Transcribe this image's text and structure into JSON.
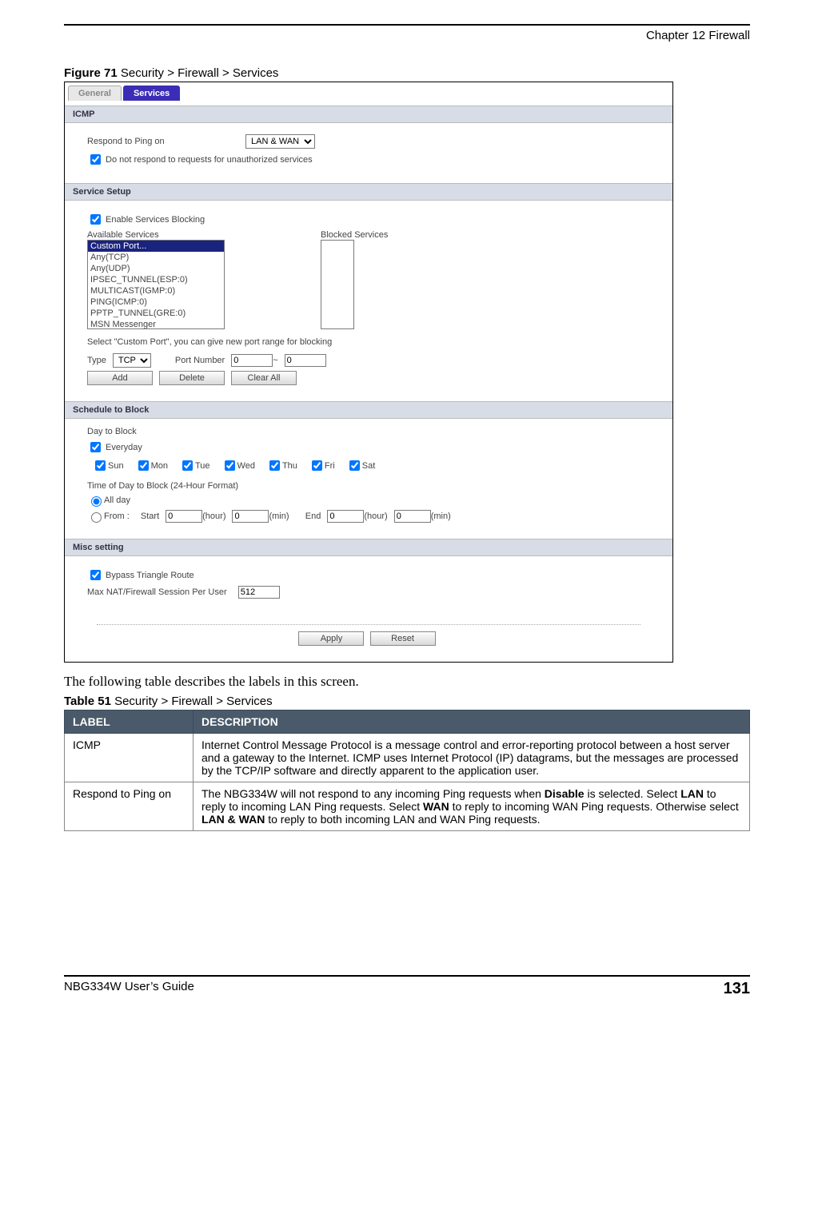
{
  "chapter_header": "Chapter 12 Firewall",
  "figure_caption_bold": "Figure 71",
  "figure_caption_rest": "   Security > Firewall > Services",
  "tabs": {
    "general": "General",
    "services": "Services"
  },
  "icmp": {
    "title": "ICMP",
    "respond_label": "Respond to Ping on",
    "respond_value": "LAN & WAN",
    "no_respond_label": "Do not respond to requests for unauthorized services"
  },
  "service_setup": {
    "title": "Service Setup",
    "enable_label": "Enable Services Blocking",
    "available_label": "Available Services",
    "blocked_label": "Blocked Services",
    "items": [
      "Custom Port...",
      "Any(TCP)",
      "Any(UDP)",
      "IPSEC_TUNNEL(ESP:0)",
      "MULTICAST(IGMP:0)",
      "PING(ICMP:0)",
      "PPTP_TUNNEL(GRE:0)",
      "MSN Messenger"
    ],
    "hint": "Select \"Custom Port\", you can give new port range for blocking",
    "type_label": "Type",
    "type_value": "TCP",
    "port_label": "Port Number",
    "port_from": "0",
    "port_tilde": "~",
    "port_to": "0",
    "btn_add": "Add",
    "btn_delete": "Delete",
    "btn_clear": "Clear All"
  },
  "schedule": {
    "title": "Schedule to Block",
    "day_label": "Day to Block",
    "everyday": "Everyday",
    "days": [
      "Sun",
      "Mon",
      "Tue",
      "Wed",
      "Thu",
      "Fri",
      "Sat"
    ],
    "time_label": "Time of Day to Block (24-Hour Format)",
    "allday": "All day",
    "from": "From :",
    "start": "Start",
    "hour_unit": "(hour)",
    "min_unit": "(min)",
    "end": "End",
    "val0": "0"
  },
  "misc": {
    "title": "Misc setting",
    "bypass": "Bypass Triangle Route",
    "max_label": "Max NAT/Firewall Session Per User",
    "max_value": "512"
  },
  "footer_btns": {
    "apply": "Apply",
    "reset": "Reset"
  },
  "after_figure": "The following table describes the labels in this screen.",
  "table_caption_bold": "Table 51",
  "table_caption_rest": "   Security > Firewall > Services",
  "table": {
    "h1": "LABEL",
    "h2": "DESCRIPTION",
    "r1c1": "ICMP",
    "r1c2": "Internet Control Message Protocol is a message control and error-reporting protocol between a host server and a gateway to the Internet. ICMP uses Internet Protocol (IP) datagrams, but the messages are processed by the TCP/IP software and directly apparent to the application user.",
    "r2c1": "Respond to Ping on",
    "r2c2_a": "The NBG334W will not respond to any incoming Ping requests when ",
    "r2c2_b1": "Disable",
    "r2c2_c": " is selected. Select ",
    "r2c2_b2": "LAN",
    "r2c2_d": " to reply to incoming LAN Ping requests. Select ",
    "r2c2_b3": "WAN",
    "r2c2_e": " to reply to incoming WAN Ping requests. Otherwise select ",
    "r2c2_b4": "LAN & WAN",
    "r2c2_f": " to reply to both incoming LAN and WAN Ping requests."
  },
  "page_footer": {
    "guide": "NBG334W User’s Guide",
    "page": "131"
  }
}
